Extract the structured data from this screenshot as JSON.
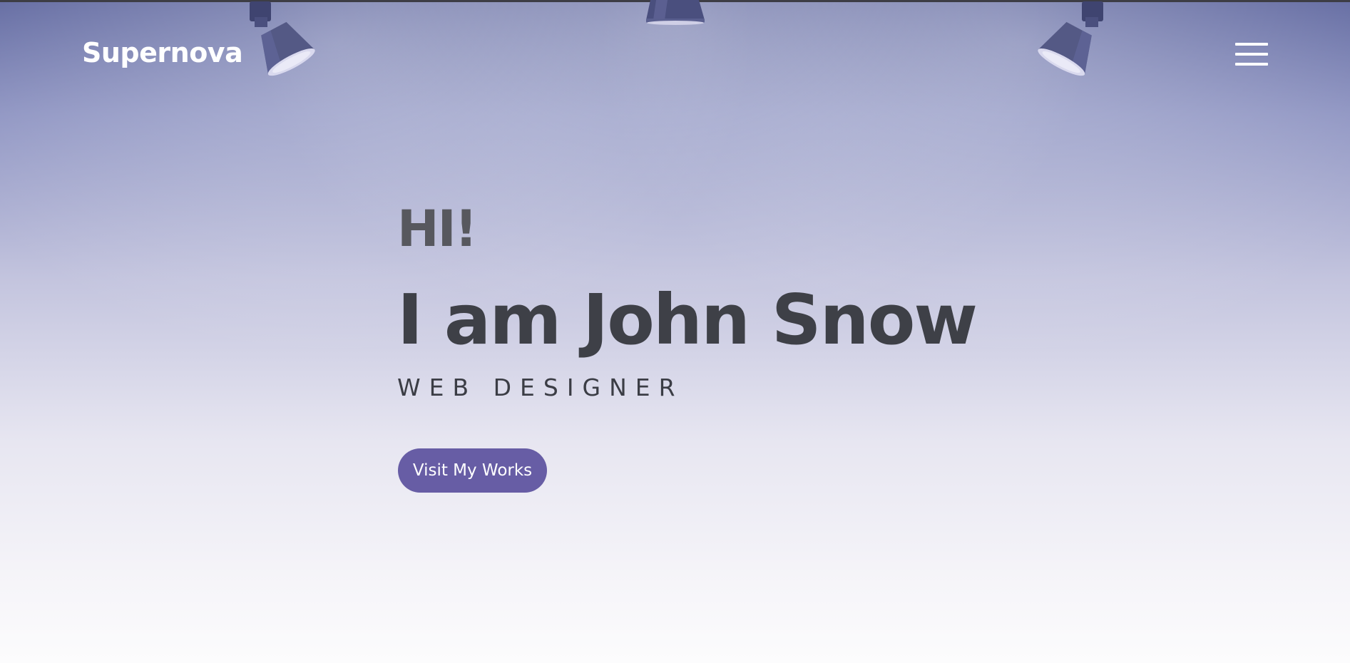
{
  "header": {
    "brand": "Supernova",
    "menu_icon": "hamburger-menu-icon"
  },
  "hero": {
    "greeting": "HI!",
    "headline": "I am John Snow",
    "role": "WEB DESIGNER",
    "cta_label": "Visit My Works"
  },
  "decor": {
    "lamp_icon": "spotlight-lamp-icon"
  },
  "colors": {
    "accent": "#675da5",
    "heading": "#3e4047",
    "greeting": "#57585e",
    "background_top": "#5f679f",
    "background_bottom": "#fcfcfd"
  }
}
